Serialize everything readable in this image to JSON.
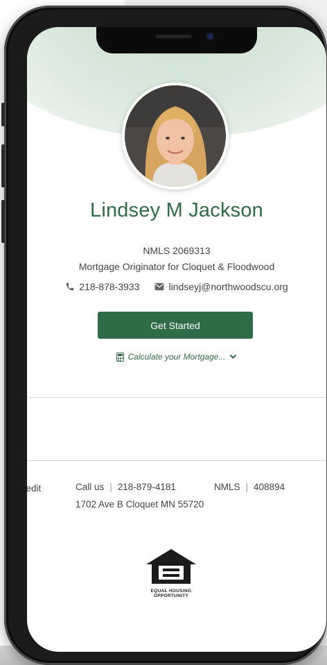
{
  "profile": {
    "name": "Lindsey M Jackson",
    "nmls": "NMLS  2069313",
    "title": "Mortgage Originator for Cloquet & Floodwood",
    "phone": "218-878-3933",
    "email": "lindseyj@northwoodscu.org"
  },
  "actions": {
    "get_started": "Get Started",
    "calculate": "Calculate your Mortgage..."
  },
  "footer": {
    "credit_fragment": "redit",
    "call_label": "Call us",
    "call_number": "218-879-4181",
    "nmls_label": "NMLS",
    "nmls_number": "408894",
    "address": "1702 Ave B Cloquet MN 55720",
    "eho_line1": "EQUAL HOUSING",
    "eho_line2": "OPPORTUNITY"
  },
  "colors": {
    "brand_green": "#2f6b46",
    "text": "#444444"
  },
  "icons": [
    "phone-icon",
    "email-icon",
    "calculator-icon",
    "chevron-down-icon",
    "equal-housing-icon"
  ]
}
